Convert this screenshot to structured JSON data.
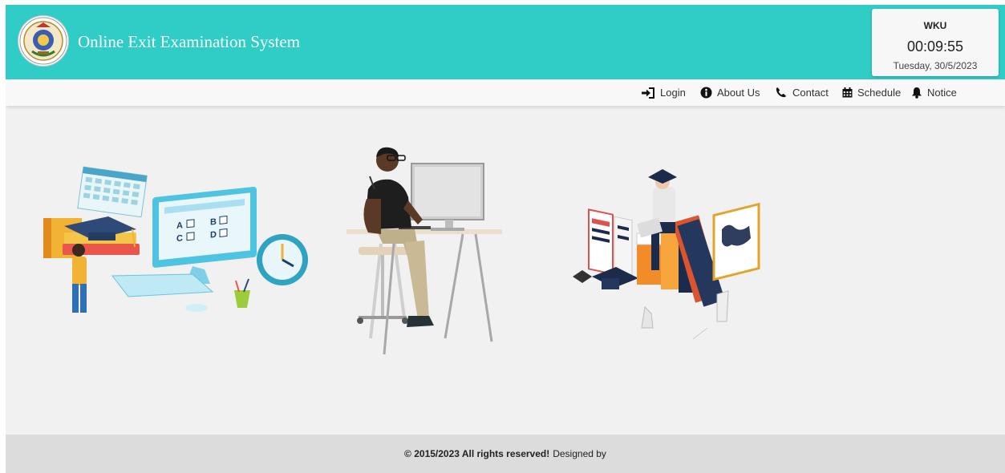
{
  "header": {
    "title": "Online Exit Examination System",
    "logo_icon": "university-seal-icon",
    "background": "#2fcdc6"
  },
  "clock": {
    "brand": "WKU",
    "time": "00:09:55",
    "date": "Tuesday, 30/5/2023"
  },
  "nav": {
    "items": [
      {
        "label": "Login",
        "icon": "sign-in-icon"
      },
      {
        "label": "About Us",
        "icon": "info-circle-icon"
      },
      {
        "label": "Contact",
        "icon": "phone-icon"
      },
      {
        "label": "Schedule",
        "icon": "calendar-icon"
      },
      {
        "label": "Notice",
        "icon": "bell-icon"
      }
    ]
  },
  "illustrations": [
    {
      "icon": "online-exam-computer-illustration"
    },
    {
      "icon": "student-at-desk-illustration"
    },
    {
      "icon": "graduate-books-illustration"
    }
  ],
  "footer": {
    "copyright": "© 2015/2023 All rights reserved!",
    "designed_by": "Designed by"
  }
}
